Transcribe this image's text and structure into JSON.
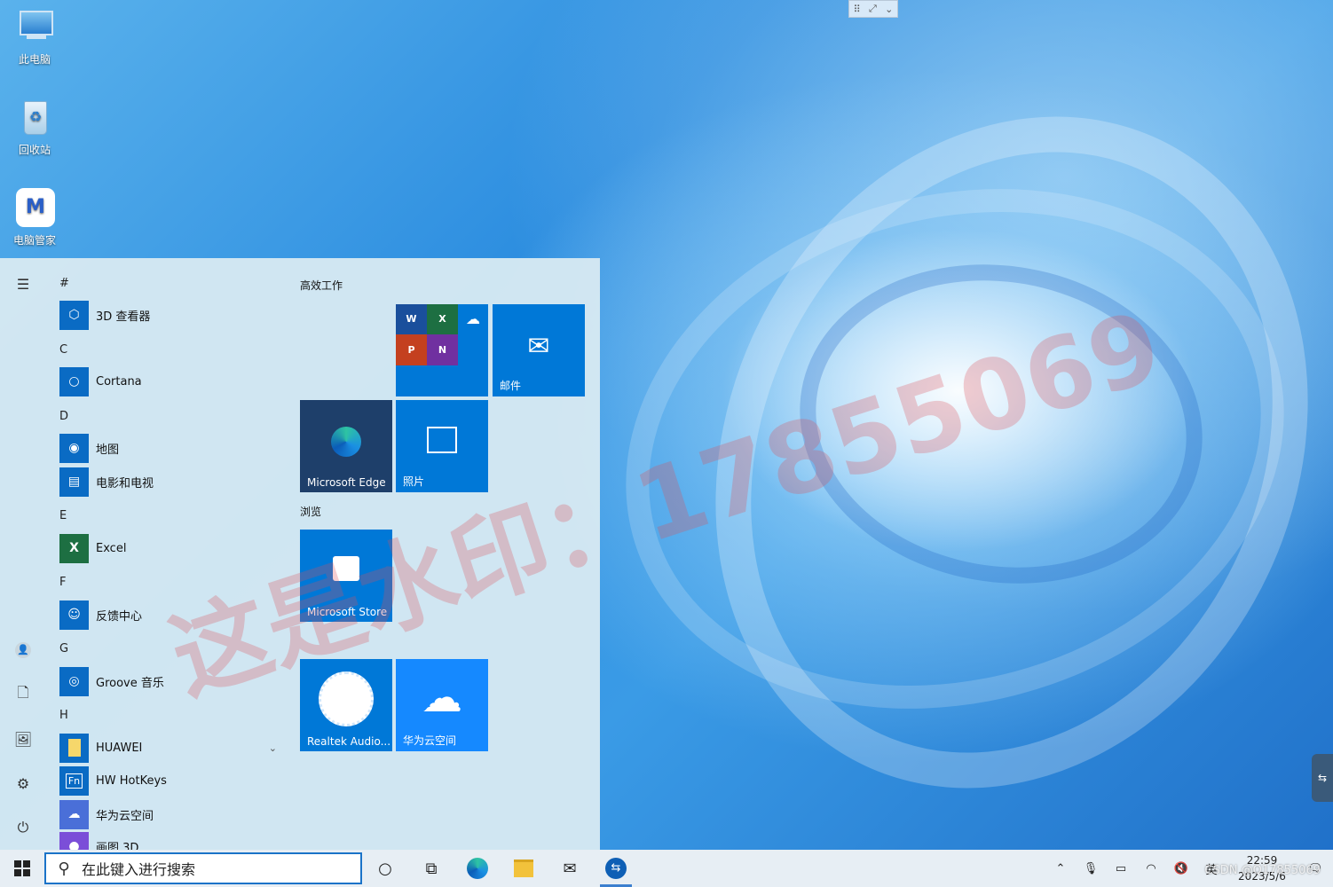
{
  "desktop": {
    "icons": [
      {
        "label": "此电脑",
        "icon": "computer-icon"
      },
      {
        "label": "回收站",
        "icon": "recycle-bin-icon"
      },
      {
        "label": "电脑管家",
        "icon": "pc-manager-icon"
      }
    ]
  },
  "start_menu": {
    "rail": [
      "hamburger-icon",
      "user-icon",
      "document-icon",
      "pictures-icon",
      "settings-icon",
      "power-icon"
    ],
    "letters": [
      "#",
      "C",
      "D",
      "E",
      "F",
      "G",
      "H"
    ],
    "apps": [
      {
        "label": "3D 查看器",
        "color": "#0a6bc4"
      },
      {
        "label": "Cortana",
        "color": "#0a6bc4"
      },
      {
        "label": "地图",
        "color": "#0a6bc4"
      },
      {
        "label": "电影和电视",
        "color": "#0a6bc4"
      },
      {
        "label": "Excel",
        "color": "#1d6f42"
      },
      {
        "label": "反馈中心",
        "color": "#0a6bc4"
      },
      {
        "label": "Groove 音乐",
        "color": "#0a6bc4"
      },
      {
        "label": "HUAWEI",
        "color": "#0a6bc4"
      },
      {
        "label": "HW HotKeys",
        "color": "#0a6bc4"
      },
      {
        "label": "华为云空间",
        "color": "#4a6fd8"
      },
      {
        "label": "画图 3D",
        "color": "#7b4ed8"
      }
    ],
    "groups": [
      "高效工作",
      "浏览"
    ],
    "tiles": {
      "office": "",
      "mail": "邮件",
      "edge": "Microsoft Edge",
      "photos": "照片",
      "store": "Microsoft Store",
      "realtek": "Realtek Audio...",
      "huawei_cloud": "华为云空间"
    },
    "colors": {
      "tile_blue": "#0078d7",
      "edge_dark": "#1e3f6a",
      "cloud_blue": "#1589ff"
    }
  },
  "watermark": "这是水印：17855069",
  "taskbar": {
    "search_placeholder": "在此键入进行搜索",
    "tray": {
      "ime": "英",
      "time": "22:59",
      "date": "2023/5/6"
    }
  },
  "csdn_mark": "CSDN @Q17855069"
}
